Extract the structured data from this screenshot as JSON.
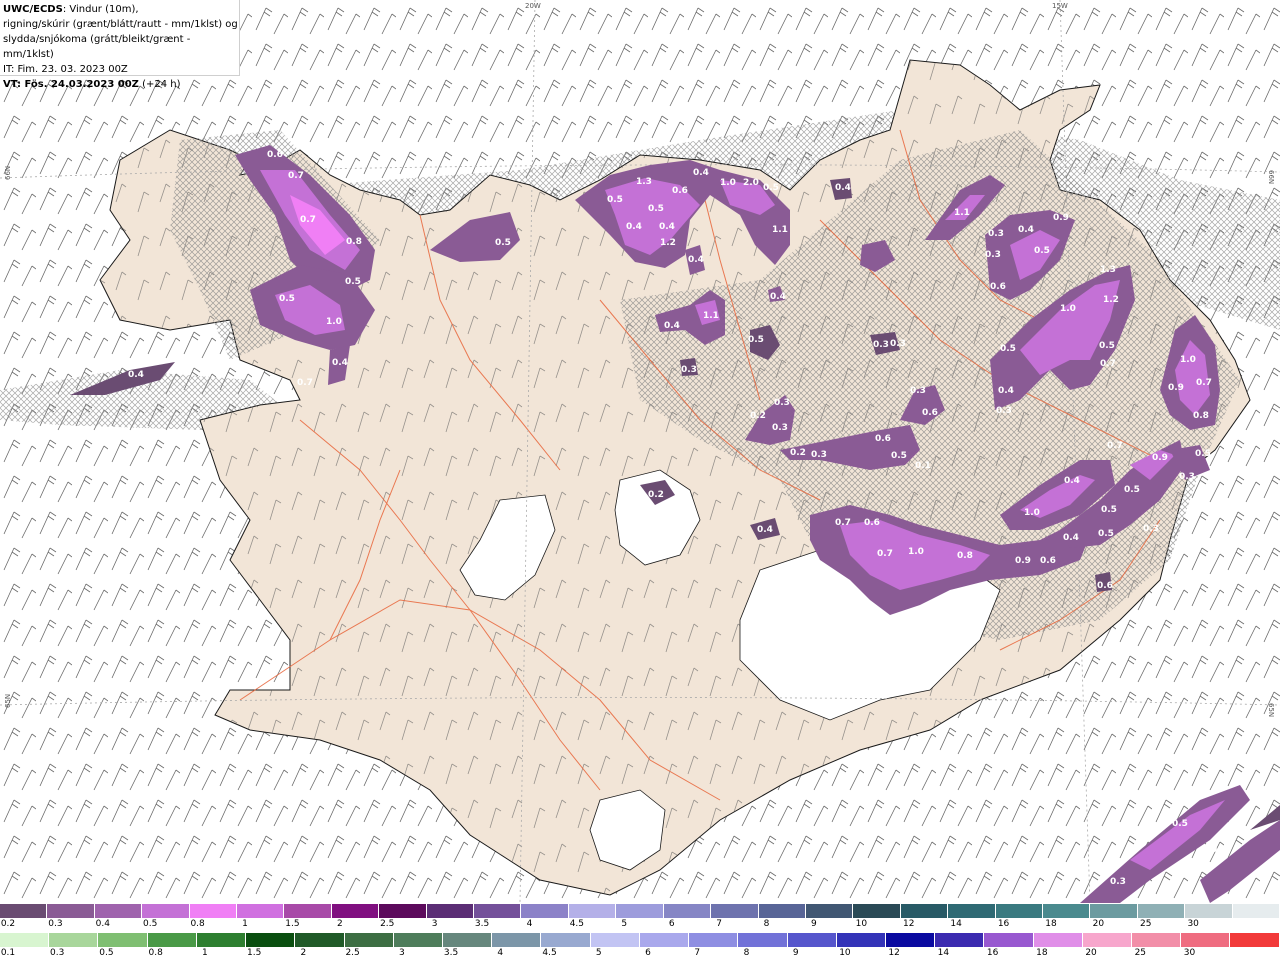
{
  "info": {
    "model": "UWC/ECDS",
    "line1_rest": ": Vindur (10m),",
    "line2": "rigning/skúrir (grænt/blátt/rautt - mm/1klst) og",
    "line3": "slydda/snjókoma (grátt/bleikt/grænt - mm/1klst)",
    "line4": "IT: Fim. 23. 03. 2023 00Z",
    "line5_bold": "VT: Fös. 24.03.2023 00Z",
    "line5_rest": " (+24 h)"
  },
  "grid_labels": {
    "top_20w": "20W",
    "top_15w": "15W",
    "left_66n": "66N",
    "left_65n": "65N",
    "right_66n": "66N",
    "right_65n": "65N"
  },
  "precip_labels": [
    "0.6",
    "0.7",
    "0.7",
    "0.8",
    "0.5",
    "0.5",
    "1.0",
    "0.4",
    "0.7",
    "0.4",
    "0.5",
    "1.3",
    "0.6",
    "0.4",
    "1.0",
    "2.0",
    "0.5",
    "0.5",
    "0.5",
    "0.4",
    "0.4",
    "1.1",
    "1.2",
    "0.4",
    "0.4",
    "1.1",
    "0.4",
    "0.5",
    "0.3",
    "0.3",
    "0.2",
    "0.6",
    "0.3",
    "0.3",
    "0.3",
    "0.2",
    "0.3",
    "0.6",
    "0.5",
    "0.3",
    "0.1",
    "0.2",
    "0.4",
    "0.7",
    "0.6",
    "0.7",
    "1.0",
    "0.8",
    "0.9",
    "0.6",
    "0.4",
    "1.1",
    "0.3",
    "0.4",
    "0.3",
    "0.5",
    "0.9",
    "0.6",
    "1.0",
    "1.3",
    "1.2",
    "0.5",
    "0.4",
    "0.3",
    "0.5",
    "0.7",
    "1.0",
    "0.9",
    "0.7",
    "0.8",
    "0.7",
    "0.9",
    "0.5",
    "0.3",
    "0.4",
    "0.5",
    "1.0",
    "0.5",
    "0.4",
    "0.5",
    "0.3",
    "0.6",
    "0.5",
    "0.3",
    "0.3"
  ],
  "legend_top": {
    "ticks": [
      "0.2",
      "0.3",
      "0.4",
      "0.5",
      "0.8",
      "1",
      "1.5",
      "2",
      "2.5",
      "3",
      "3.5",
      "4",
      "4.5",
      "5",
      "6",
      "7",
      "8",
      "9",
      "10",
      "12",
      "14",
      "16",
      "18",
      "20",
      "25",
      "30"
    ],
    "colors": [
      "#6a4c72",
      "#8a5b95",
      "#9f63ad",
      "#c471d6",
      "#f07ff5",
      "#d070e0",
      "#a84aa8",
      "#800f80",
      "#5c0a5c",
      "#5b2d75",
      "#74509a",
      "#8c82c8",
      "#b4b0e8",
      "#9d9cdc",
      "#8686c5",
      "#6e73ae",
      "#586597",
      "#415773",
      "#2a4a56",
      "#285a66",
      "#2f6a74",
      "#3a7a80",
      "#4a8a8e",
      "#6c9ba0",
      "#8fb0b5",
      "#c8d4d7",
      "#e6ecee"
    ]
  },
  "legend_bottom": {
    "ticks": [
      "0.1",
      "0.3",
      "0.5",
      "0.8",
      "1",
      "1.5",
      "2",
      "2.5",
      "3",
      "3.5",
      "4",
      "4.5",
      "5",
      "6",
      "7",
      "8",
      "9",
      "10",
      "12",
      "14",
      "16",
      "18",
      "20",
      "25",
      "30"
    ],
    "colors": [
      "#d8f5d0",
      "#a8d69b",
      "#7fbf72",
      "#4a9a47",
      "#2e7f30",
      "#0a4f10",
      "#205a28",
      "#3c6e43",
      "#4e7d5b",
      "#66877d",
      "#7c96a8",
      "#98a9d0",
      "#c2c4f3",
      "#a9a8ec",
      "#8e8ee2",
      "#7272d8",
      "#5656cc",
      "#3333b8",
      "#0a0aa0",
      "#3b2ab0",
      "#9858d0",
      "#e08ee8",
      "#f7a6cc",
      "#f28ea8",
      "#ef6c80",
      "#f23a3a"
    ]
  }
}
